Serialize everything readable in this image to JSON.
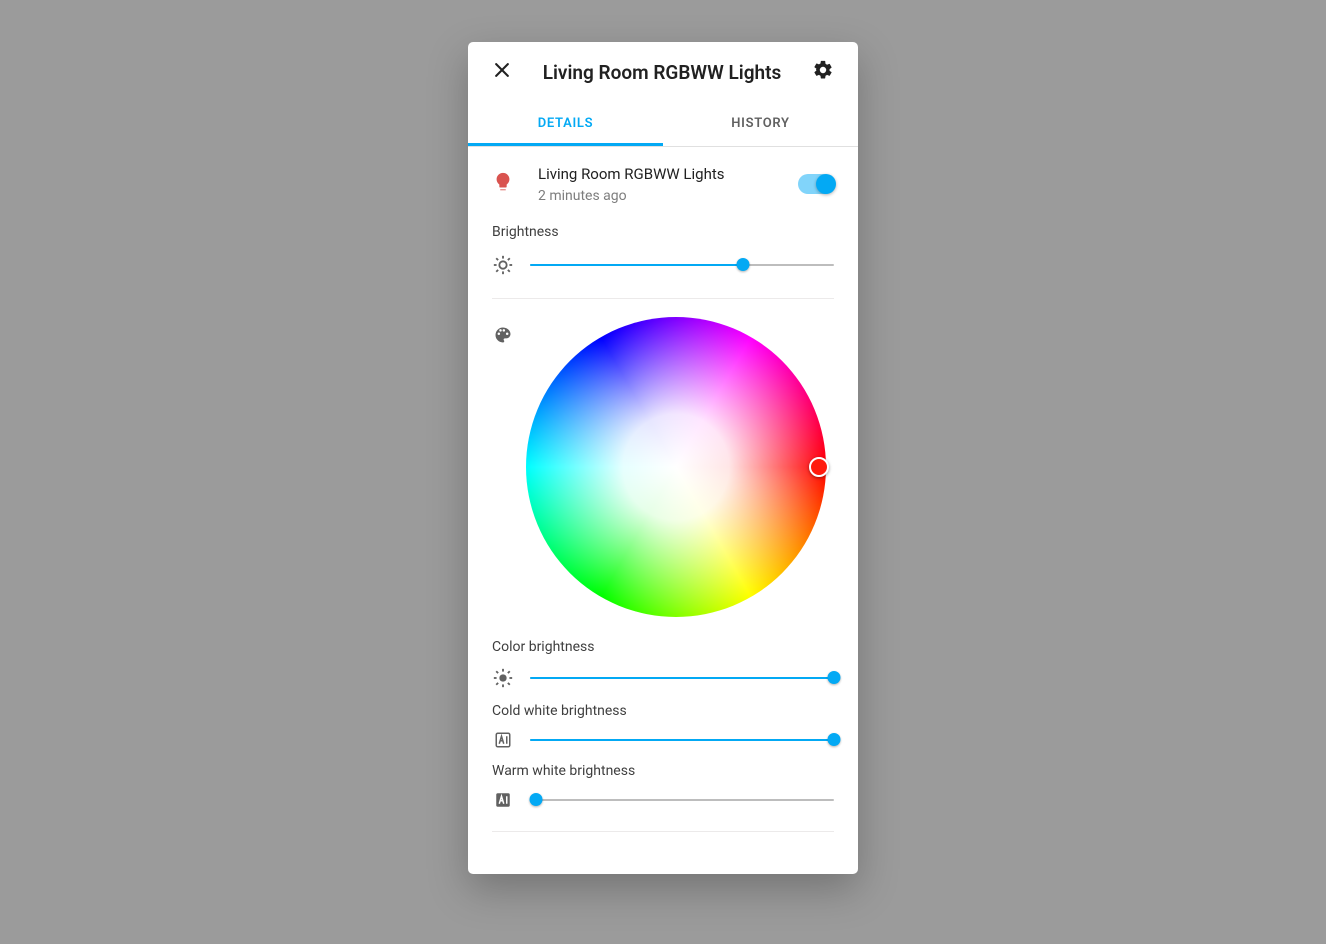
{
  "header": {
    "title": "Living Room RGBWW Lights"
  },
  "tabs": {
    "details": "Details",
    "history": "History",
    "active_index": 0
  },
  "entity": {
    "name": "Living Room RGBWW Lights",
    "last_changed": "2 minutes ago",
    "state_on": true
  },
  "brightness": {
    "label": "Brightness",
    "percent": 70
  },
  "color_wheel": {
    "selected_hex": "#ff1b0d"
  },
  "sliders": {
    "color_brightness": {
      "label": "Color brightness",
      "percent": 100
    },
    "cold_white": {
      "label": "Cold white brightness",
      "percent": 100
    },
    "warm_white": {
      "label": "Warm white brightness",
      "percent": 2
    }
  }
}
